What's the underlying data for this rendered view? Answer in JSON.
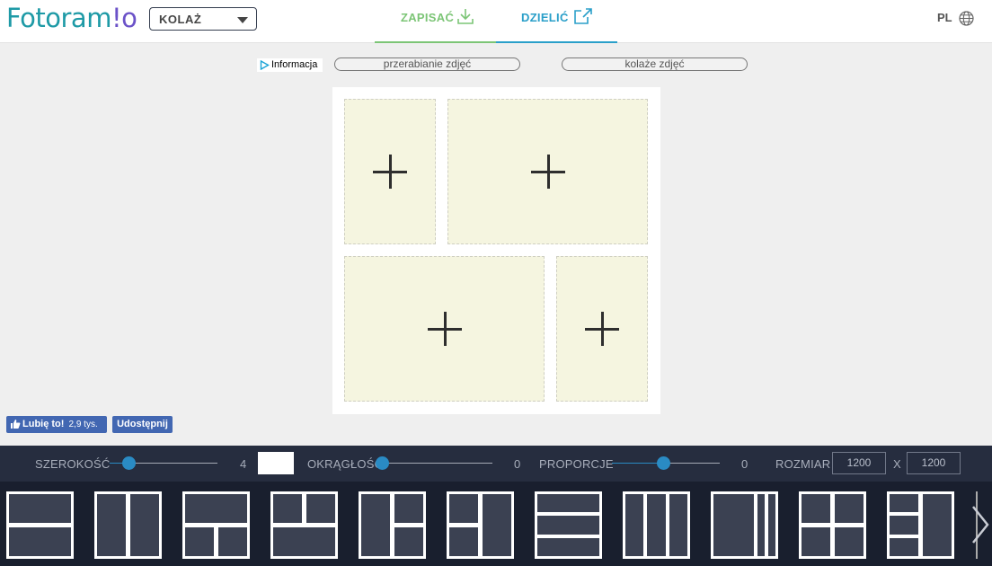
{
  "header": {
    "logo_part1": "Fotoram",
    "logo_part2": "!o",
    "mode": "KOLAŻ",
    "tabs": [
      {
        "label": "ZAPISAĆ",
        "icon": "download-icon",
        "color": "#7cc576"
      },
      {
        "label": "DZIELIĆ",
        "icon": "share-icon",
        "color": "#2a9fc9"
      }
    ],
    "language": "PL"
  },
  "subbar": {
    "ad_info": "Informacja",
    "link1": "przerabianie zdjęć",
    "link2": "kolaże zdjęć"
  },
  "social": {
    "like_label": "Lubię to!",
    "like_count": "2,9 tys.",
    "share_label": "Udostępnij"
  },
  "controls": {
    "width_label": "SZEROKOŚĆ",
    "width_value": "4",
    "roundness_label": "OKRĄGŁOŚĆ",
    "roundness_value": "0",
    "proportion_label": "PROPORCJE",
    "proportion_value": "0",
    "size_label": "ROZMIAR",
    "size_width": "1200",
    "size_x": "X",
    "size_height": "1200",
    "border_color": "#ffffff"
  },
  "colors": {
    "accent_blue": "#2a9fc9",
    "accent_green": "#7cc576",
    "bar_bg": "#262d3f",
    "cell_bg": "#f5f5e0"
  }
}
